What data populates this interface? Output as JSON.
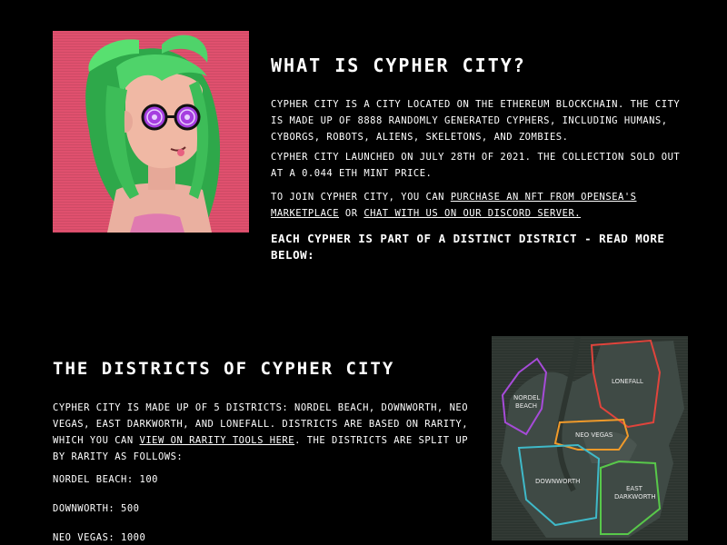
{
  "about": {
    "title": "What is Cypher City?",
    "p1": "Cypher City is a city located on the Ethereum blockchain. The city is made up of 8888 randomly generated Cyphers, including humans, cyborgs, robots, aliens, skeletons, and zombies.",
    "p2": "Cypher City launched on July 28th of 2021. The collection sold out at a 0.044 ETH mint price.",
    "p3_before": "To join Cypher City, you can ",
    "p3_link1": "purchase an NFT from OpenSea's marketplace",
    "p3_middle": " or ",
    "p3_link2": "chat with us on our Discord server.",
    "callout": "Each Cypher is part of a distinct district - read more below:"
  },
  "districts": {
    "title": "The Districts of Cypher City",
    "intro_before": "Cypher City is made up of 5 districts: Nordel Beach, Downworth, Neo Vegas, East Darkworth, and Lonefall. Districts are based on rarity, which you can ",
    "intro_link": "view on Rarity Tools here",
    "intro_after": ". The districts are split up by rarity as follows:",
    "rarity": [
      {
        "text": "Nordel Beach: 100"
      },
      {
        "text": "Downworth: 500"
      },
      {
        "text": "Neo Vegas: 1000"
      }
    ]
  },
  "map": {
    "labels": {
      "nordel": "NORDEL",
      "nordel2": "BEACH",
      "lonefall": "LONEFALL",
      "neovegas": "NEO VEGAS",
      "downworth": "DOWNWORTH",
      "east": "EAST",
      "darkworth": "DARKWORTH"
    },
    "colors": {
      "nordel": "#a64bd8",
      "lonefall": "#e0443c",
      "neovegas": "#f09a2a",
      "downworth": "#3fb9c8",
      "darkworth": "#58c84a"
    }
  },
  "art": {
    "background": "#e0506e",
    "hair": "#4fd36a",
    "lens": "#a63ee0"
  }
}
